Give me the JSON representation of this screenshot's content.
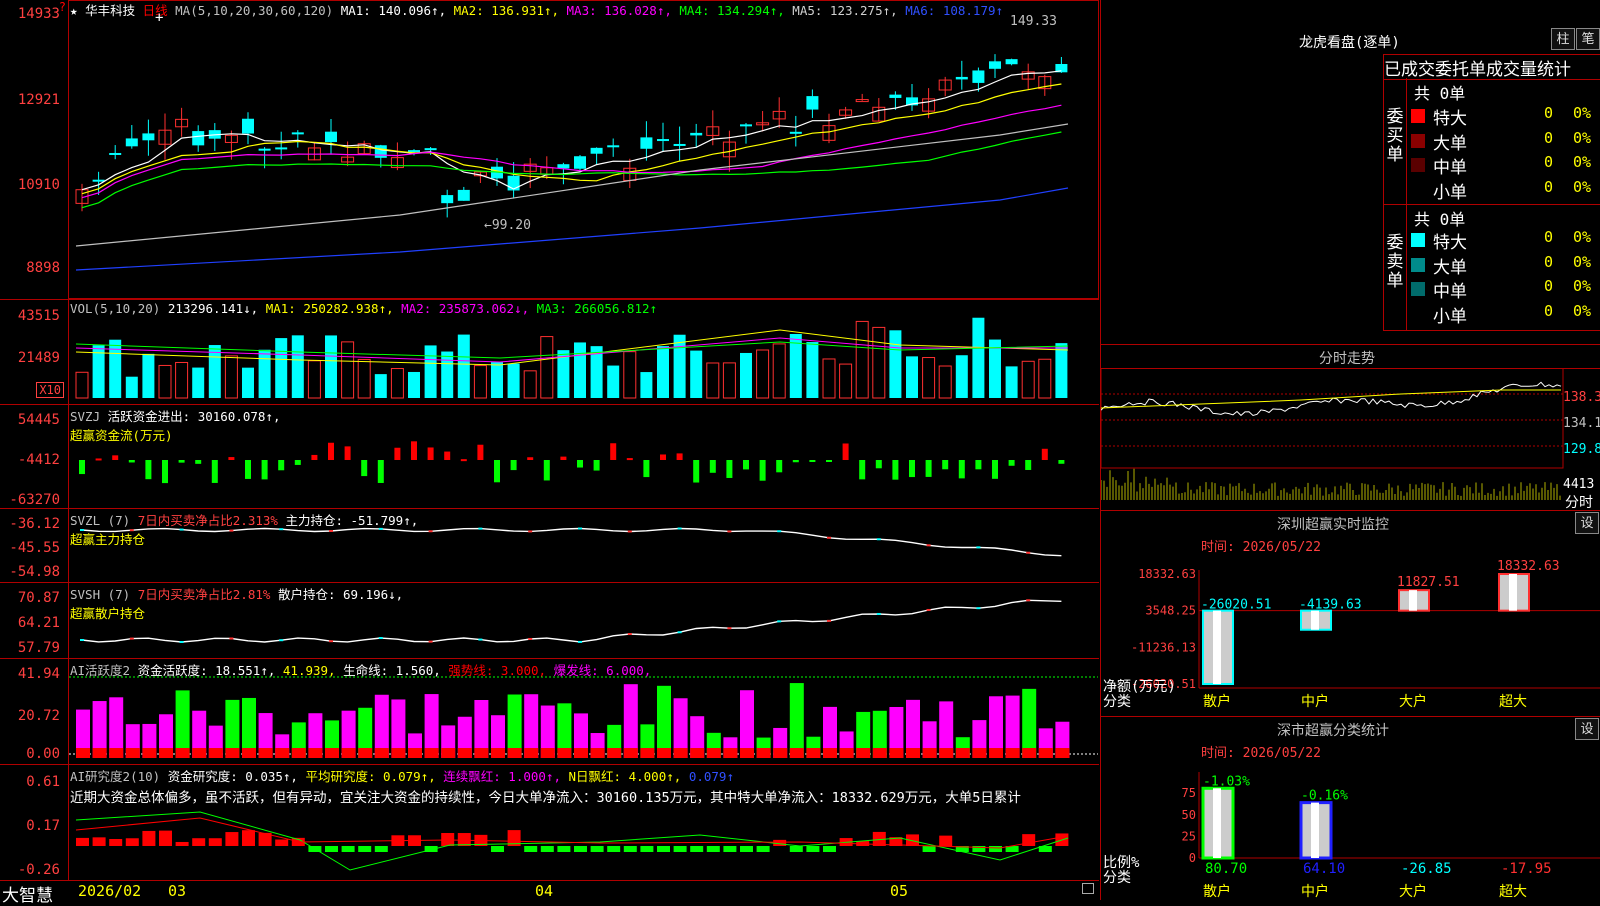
{
  "stock": {
    "name": "华丰科技",
    "star": "★",
    "period": "日线",
    "cursor": "+"
  },
  "kline": {
    "ma_label": "MA(5,10,20,30,60,120)",
    "ma1": "MA1: 140.096↑,",
    "ma2": "MA2: 136.931↑,",
    "ma3": "MA3: 136.028↑,",
    "ma4": "MA4: 134.294↑,",
    "ma5": "MA5: 123.275↑,",
    "ma6": "MA6: 108.179↑",
    "yticks": [
      "14933",
      "12921",
      "10910",
      "8898"
    ],
    "high_label": "149.33",
    "low_label": "←99.20",
    "flag": "?"
  },
  "volume": {
    "label": "VOL(5,10,20)",
    "val": "213296.141↓,",
    "ma1": "MA1: 250282.938↑,",
    "ma2": "MA2: 235873.062↓,",
    "ma3": "MA3: 266056.812↑",
    "yticks": [
      "43515",
      "21489"
    ],
    "unit": "X10"
  },
  "svzj": {
    "label": "SVZJ",
    "title": "活跃资金进出: 30160.078↑,",
    "subtitle": "超赢资金流(万元)",
    "yticks": [
      "54445",
      "-4412",
      "-63270"
    ]
  },
  "svzl": {
    "label": "SVZL (7)",
    "t1": "7日内买卖净占比2.313%",
    "t2": "主力持仓: -51.799↑,",
    "subtitle": "超赢主力持仓",
    "yticks": [
      "-36.12",
      "-45.55",
      "-54.98"
    ]
  },
  "svsh": {
    "label": "SVSH (7)",
    "t1": "7日内买卖净占比2.81%",
    "t2": "散户持仓: 69.196↓,",
    "subtitle": "超赢散户持仓",
    "yticks": [
      "70.87",
      "64.21",
      "57.79"
    ]
  },
  "ai1": {
    "label": "AI活跃度2",
    "t1": "资金活跃度: 18.551↑,",
    "t2": "41.939,",
    "t3": "生命线: 1.560,",
    "t4": "强势线: 3.000,",
    "t5": "爆发线: 6.000,",
    "yticks": [
      "41.94",
      "20.72",
      "0.00"
    ]
  },
  "ai2": {
    "label": "AI研究度2(10)",
    "t1": "资金研究度: 0.035↑,",
    "t2": "平均研究度: 0.079↑,",
    "t3": "连续飘红: 1.000↑,",
    "t4": "N日飘红: 4.000↑,",
    "t5": "0.079↑",
    "comment": "近期大资金总体偏多，虽不活跃，但有异动，宜关注大资金的持续性，今日大单净流入：30160.135万元，其中特大单净流入：18332.629万元，大单5日累计",
    "yticks": [
      "0.61",
      "0.17",
      "-0.26"
    ]
  },
  "bottom": {
    "brand": "大智慧",
    "dates": [
      "2026/02",
      "03",
      "04",
      "05"
    ]
  },
  "longhu": {
    "title": "龙虎看盘(逐单)",
    "btn1": "柱",
    "btn2": "笔",
    "header": "已成交委托单成交量统计",
    "buy": {
      "label": "委买单",
      "total": "共 0单",
      "rows": [
        {
          "name": "特大",
          "count": "0",
          "pct": "0%",
          "color": "#ff0000"
        },
        {
          "name": "大单",
          "count": "0",
          "pct": "0%",
          "color": "#8b0000"
        },
        {
          "name": "中单",
          "count": "0",
          "pct": "0%",
          "color": "#5a0000"
        },
        {
          "name": "小单",
          "count": "0",
          "pct": "0%",
          "color": "#000000"
        }
      ]
    },
    "sell": {
      "label": "委卖单",
      "total": "共 0单",
      "rows": [
        {
          "name": "特大",
          "count": "0",
          "pct": "0%",
          "color": "#00ffff"
        },
        {
          "name": "大单",
          "count": "0",
          "pct": "0%",
          "color": "#008b8b"
        },
        {
          "name": "中单",
          "count": "0",
          "pct": "0%",
          "color": "#006b6b"
        },
        {
          "name": "小单",
          "count": "0",
          "pct": "0%",
          "color": "#000000"
        }
      ]
    }
  },
  "fenshi": {
    "title": "分时走势",
    "prices": [
      "138.3",
      "134.1",
      "129.8"
    ],
    "vol": "4413",
    "unit": "分时"
  },
  "monitor": {
    "title": "深圳超赢实时监控",
    "btn": "设",
    "time": "时间: 2026/05/22",
    "yticks": [
      "18332.63",
      "3548.25",
      "-11236.13",
      "-26020.51"
    ],
    "ylabel1": "净额(万元)",
    "ylabel2": "分类",
    "chart_data": {
      "type": "bar",
      "categories": [
        "散户",
        "中户",
        "大户",
        "超大"
      ],
      "values": [
        -26020.51,
        -4139.63,
        11827.51,
        18332.63
      ],
      "ylim": [
        -26020.51,
        18332.63
      ]
    },
    "value_labels": [
      "-26020.51",
      "-4139.63",
      "11827.51",
      "18332.63"
    ]
  },
  "classify": {
    "title": "深市超赢分类统计",
    "btn": "设",
    "time": "时间: 2026/05/22",
    "yticks": [
      "75",
      "50",
      "25",
      "0"
    ],
    "ylabel1": "比例%",
    "ylabel2": "分类",
    "chart_data": {
      "type": "bar",
      "categories": [
        "散户",
        "中户",
        "大户",
        "超大"
      ],
      "values": [
        80.7,
        64.1,
        -26.85,
        -17.95
      ],
      "changes": [
        "-1.03%",
        "-0.16%",
        "",
        ""
      ],
      "ylim": [
        0,
        100
      ]
    },
    "value_labels": [
      "80.70",
      "64.10",
      "-26.85",
      "-17.95"
    ]
  }
}
